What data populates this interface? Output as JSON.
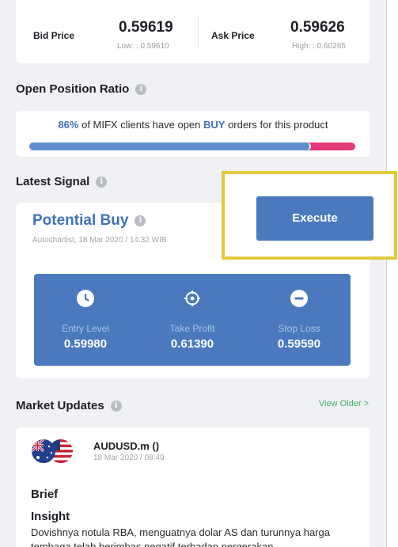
{
  "price": {
    "bid_label": "Bid Price",
    "bid_value": "0.59619",
    "bid_sub": "Low: : 0.59610",
    "ask_label": "Ask Price",
    "ask_value": "0.59626",
    "ask_sub": "High: : 0.60265"
  },
  "ratio": {
    "title": "Open Position Ratio",
    "percent": "86%",
    "text_mid": " of MIFX clients have open ",
    "direction": "BUY",
    "text_end": " orders for this product",
    "buy_fraction": 0.86
  },
  "signal": {
    "title": "Latest Signal",
    "type": "Potential Buy",
    "source": "Autochartist, 18 Mar 2020 / 14:32 WIB",
    "execute_label": "Execute",
    "levels": [
      {
        "label": "Entry Level",
        "value": "0.59980",
        "icon": "clock-icon"
      },
      {
        "label": "Take Profit",
        "value": "0.61390",
        "icon": "target-icon"
      },
      {
        "label": "Stop Loss",
        "value": "0.59590",
        "icon": "minus-circle-icon"
      }
    ]
  },
  "market": {
    "title": "Market Updates",
    "view_older": "View Older >",
    "item": {
      "symbol": "AUDUSD.m ()",
      "date": "18 Mar 2020 / 08:49",
      "brief": "Brief",
      "insight": "Insight",
      "text": "Dovishnya notula RBA, menguatnya dolar AS dan turunnya harga tembaga telah berimbas negatif terhadap pergerakan"
    }
  },
  "colors": {
    "accent_blue": "#4a79bd",
    "sell_pink": "#e33a7a",
    "highlight_yellow": "#e2c93e",
    "link_green": "#3fae6a"
  }
}
